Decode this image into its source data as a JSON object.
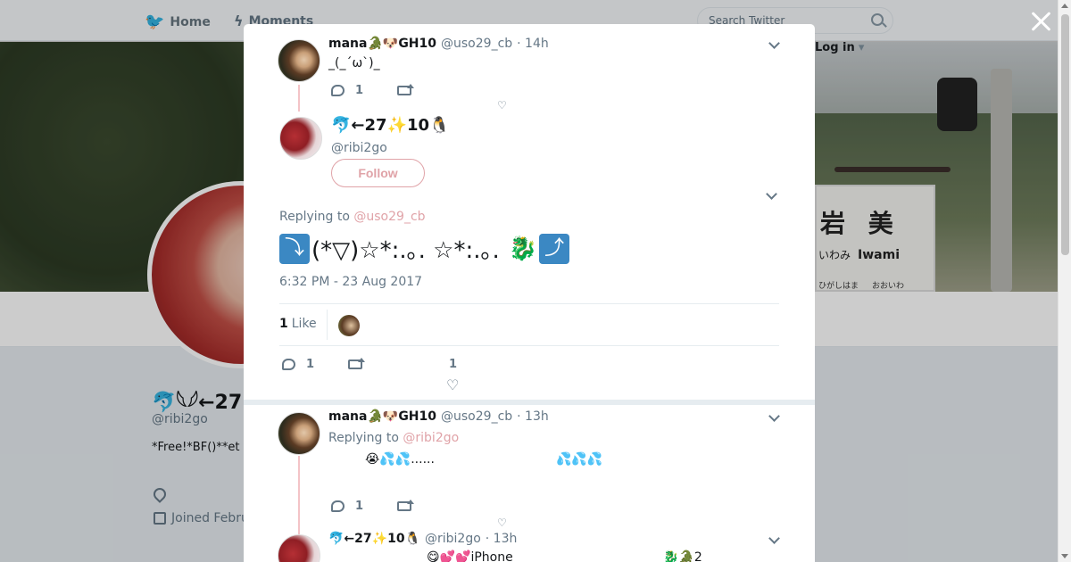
{
  "nav": {
    "home_label": "Home",
    "moments_label": "Moments",
    "search_placeholder": "Search Twitter",
    "login_label": "Log in"
  },
  "banner": {
    "sign_kanji": "岩 美",
    "sign_romaji": "いわみ",
    "sign_romaji_en": "Iwami",
    "sign_small_left": "ひがしはま",
    "sign_small_right": "おおいわ"
  },
  "profile": {
    "name": "🐬𓆩𓆪←27",
    "handle": "@ribi2go",
    "bio": "*Free!*BF()**et",
    "joined": "Joined Febru"
  },
  "modal": {
    "tweet1": {
      "name": "mana🐊🐶GH10",
      "handle": "@uso29_cb",
      "time": "· 14h",
      "text": "_(_´ω`)_",
      "replies": "1"
    },
    "focus": {
      "name": "🐬←27✨10🐧",
      "handle": "@ribi2go",
      "follow_label": "Follow",
      "replying_prefix": "Replying to",
      "replying_mention": "@uso29_cb",
      "text_a": "(*▽)☆*:.｡. ☆*:.｡.",
      "text_b": "🐉",
      "text_c": "",
      "timestamp": "6:32 PM - 23 Aug 2017",
      "likes_count": "1",
      "likes_label": "Like",
      "replies": "1",
      "favs": "1"
    },
    "tweet3": {
      "name": "mana🐊🐶GH10",
      "handle": "@uso29_cb",
      "time": "· 13h",
      "replying_prefix": "Replying to",
      "replying_mention": "@ribi2go",
      "text_a": "😭💦💦......",
      "text_b": "💦💦💦",
      "replies": "1"
    },
    "tweet4": {
      "name": "🐬←27✨10🐧",
      "handle": "@ribi2go",
      "time": "· 13h",
      "text_a": "😋💕💕iPhone",
      "text_b": "🐉🐊2"
    }
  },
  "colors": {
    "accent": "#e0a3a8",
    "link": "#1da1f2",
    "muted": "#657786"
  }
}
